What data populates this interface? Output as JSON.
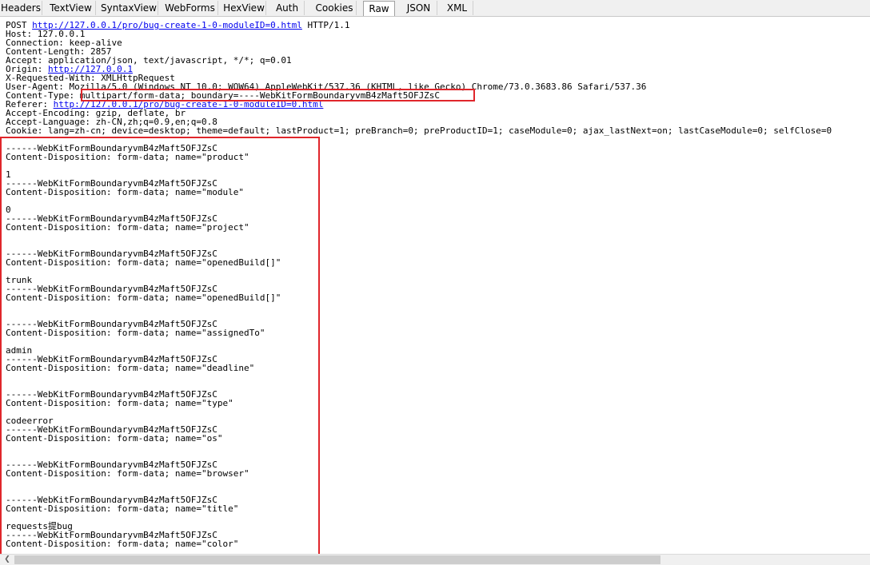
{
  "tabs": [
    "Headers",
    "TextView",
    "SyntaxView",
    "WebForms",
    "HexView",
    "Auth",
    "Cookies",
    "Raw",
    "JSON",
    "XML"
  ],
  "active_tab": "Raw",
  "request": {
    "method": "POST ",
    "url": "http://127.0.0.1/pro/bug-create-1-0-moduleID=0.html",
    "protocol": " HTTP/1.1",
    "host": "Host: 127.0.0.1",
    "connection": "Connection: keep-alive",
    "content_length": "Content-Length: 2857",
    "accept": "Accept: application/json, text/javascript, */*; q=0.01",
    "origin_label": "Origin: ",
    "origin_url": "http://127.0.0.1",
    "x_requested_with": "X-Requested-With: XMLHttpRequest",
    "user_agent": "User-Agent: Mozilla/5.0 (Windows NT 10.0; WOW64) AppleWebKit/537.36 (KHTML, like Gecko) Chrome/73.0.3683.86 Safari/537.36",
    "content_type_label": "Content-Type: ",
    "content_type_value": "multipart/form-data; boundary=----WebKitFormBoundaryvmB4zMaft5OFJZsC",
    "referer_label": "Referer: ",
    "referer_url": "http://127.0.0.1/pro/bug-create-1-0-moduleID=0.html",
    "accept_encoding": "Accept-Encoding: gzip, deflate, br",
    "accept_language": "Accept-Language: zh-CN,zh;q=0.9,en;q=0.8",
    "cookie": "Cookie: lang=zh-cn; device=desktop; theme=default; lastProduct=1; preBranch=0; preProductID=1; caseModule=0; ajax_lastNext=on; lastCaseModule=0; selfClose=0"
  },
  "body_lines": [
    "------WebKitFormBoundaryvmB4zMaft5OFJZsC",
    "Content-Disposition: form-data; name=\"product\"",
    "",
    "1",
    "------WebKitFormBoundaryvmB4zMaft5OFJZsC",
    "Content-Disposition: form-data; name=\"module\"",
    "",
    "0",
    "------WebKitFormBoundaryvmB4zMaft5OFJZsC",
    "Content-Disposition: form-data; name=\"project\"",
    "",
    "",
    "------WebKitFormBoundaryvmB4zMaft5OFJZsC",
    "Content-Disposition: form-data; name=\"openedBuild[]\"",
    "",
    "trunk",
    "------WebKitFormBoundaryvmB4zMaft5OFJZsC",
    "Content-Disposition: form-data; name=\"openedBuild[]\"",
    "",
    "",
    "------WebKitFormBoundaryvmB4zMaft5OFJZsC",
    "Content-Disposition: form-data; name=\"assignedTo\"",
    "",
    "admin",
    "------WebKitFormBoundaryvmB4zMaft5OFJZsC",
    "Content-Disposition: form-data; name=\"deadline\"",
    "",
    "",
    "------WebKitFormBoundaryvmB4zMaft5OFJZsC",
    "Content-Disposition: form-data; name=\"type\"",
    "",
    "codeerror",
    "------WebKitFormBoundaryvmB4zMaft5OFJZsC",
    "Content-Disposition: form-data; name=\"os\"",
    "",
    "",
    "------WebKitFormBoundaryvmB4zMaft5OFJZsC",
    "Content-Disposition: form-data; name=\"browser\"",
    "",
    "",
    "------WebKitFormBoundaryvmB4zMaft5OFJZsC",
    "Content-Disposition: form-data; name=\"title\"",
    "",
    "requests提bug",
    "------WebKitFormBoundaryvmB4zMaft5OFJZsC",
    "Content-Disposition: form-data; name=\"color\""
  ],
  "scroll_left_arrow": "❮",
  "highlight_color": "#e0262b"
}
